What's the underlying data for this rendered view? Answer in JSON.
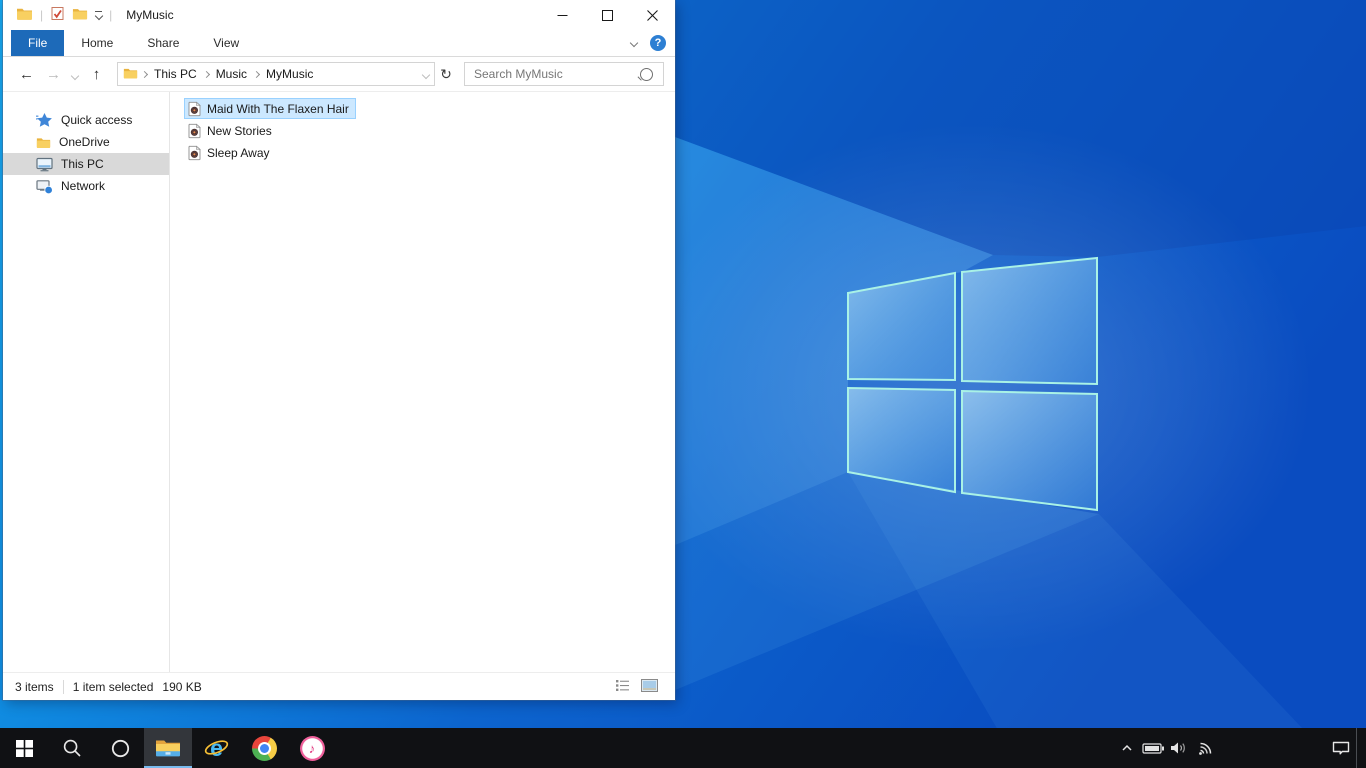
{
  "colors": {
    "file_tab_blue": "#1d6ab9",
    "selection_fill": "#cce8ff",
    "selection_border": "#99d1ff",
    "sidebar_selected": "#d9d9d9",
    "taskbar_bg": "#101114",
    "taskbar_active_underline": "#79bbee",
    "wallpaper_bright": "#18a7ec",
    "wallpaper_dark": "#0a4cc0",
    "logo_outline": "#a9f2e6",
    "help_blue": "#2d7fd3"
  },
  "titlebar": {
    "title": "MyMusic"
  },
  "ribbon": {
    "tabs": [
      {
        "label": "File"
      },
      {
        "label": "Home"
      },
      {
        "label": "Share"
      },
      {
        "label": "View"
      }
    ]
  },
  "addressbar": {
    "breadcrumbs": [
      "This PC",
      "Music",
      "MyMusic"
    ],
    "search_placeholder": "Search MyMusic"
  },
  "sidebar": {
    "items": [
      {
        "label": "Quick access"
      },
      {
        "label": "OneDrive"
      },
      {
        "label": "This PC"
      },
      {
        "label": "Network"
      }
    ]
  },
  "files": {
    "items": [
      {
        "name": "Maid With The Flaxen Hair"
      },
      {
        "name": "New Stories"
      },
      {
        "name": "Sleep Away"
      }
    ]
  },
  "statusbar": {
    "item_count": "3 items",
    "selection": "1 item selected",
    "selection_size": "190 KB"
  },
  "icons": {
    "back": "←",
    "forward": "→",
    "up": "↑",
    "refresh": "↻",
    "help": "?",
    "ie_letter": "e",
    "itunes_note": "♪"
  }
}
